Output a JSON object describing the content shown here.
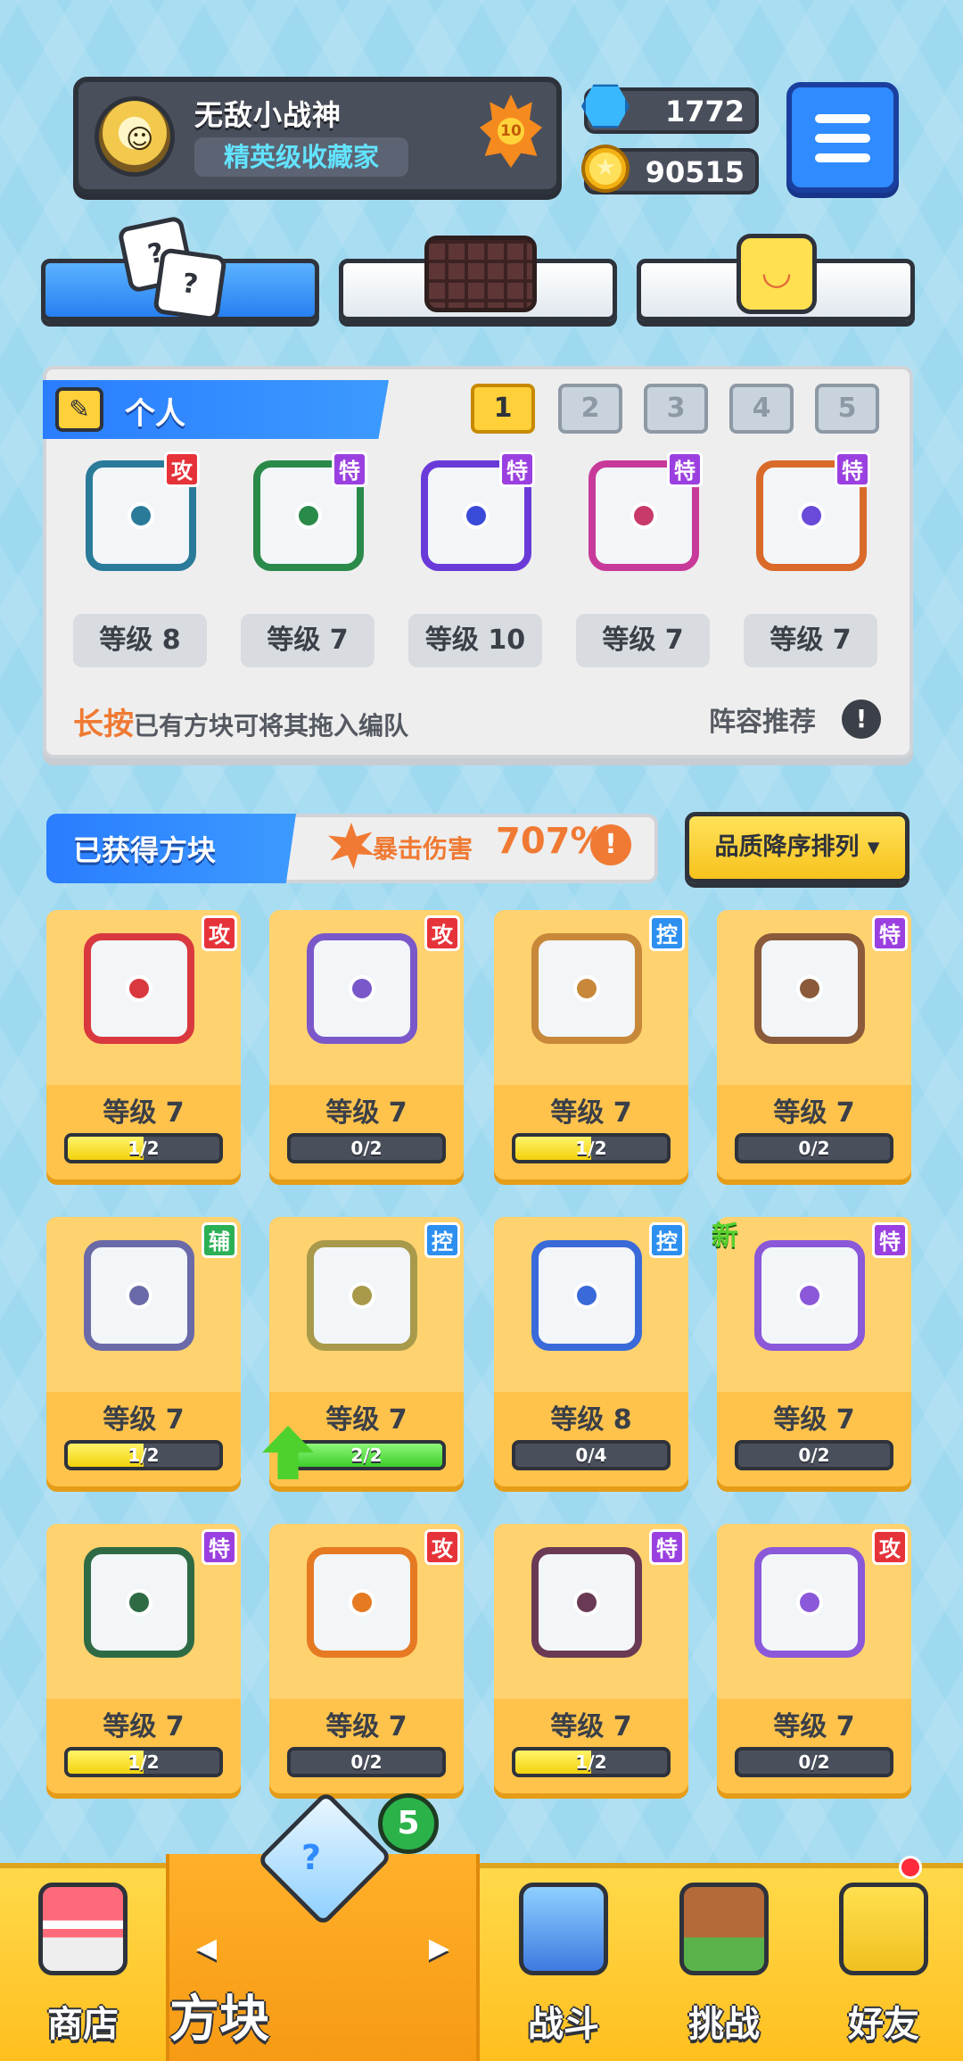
{
  "header": {
    "username": "无敌小战神",
    "rank": "精英级收藏家",
    "player_level": "10",
    "gems": "1772",
    "coins": "90515"
  },
  "top_tabs": [
    {
      "icon": "dice-icon",
      "active": true
    },
    {
      "icon": "grid-icon",
      "active": false
    },
    {
      "icon": "smile-icon",
      "active": false
    }
  ],
  "deck": {
    "title": "个人",
    "deck_numbers": [
      "1",
      "2",
      "3",
      "4",
      "5"
    ],
    "active_deck": "1",
    "slots": [
      {
        "tag": "攻",
        "level": "等级 8"
      },
      {
        "tag": "特",
        "level": "等级 7"
      },
      {
        "tag": "特",
        "level": "等级 10"
      },
      {
        "tag": "特",
        "level": "等级 7"
      },
      {
        "tag": "特",
        "level": "等级 7"
      }
    ],
    "hint_strong": "长按",
    "hint_rest": "已有方块可将其拖入编队",
    "recommend": "阵容推荐",
    "info_symbol": "!"
  },
  "obtained": {
    "title": "已获得方块",
    "crit_label": "暴击伤害",
    "crit_value": "707%",
    "info_symbol": "!",
    "sort_label": "品质降序排列 ▾"
  },
  "cards": [
    {
      "tag": "攻",
      "level": "等级 7",
      "progress": "1/2",
      "fraction": 0.5,
      "color": "#d9383e"
    },
    {
      "tag": "攻",
      "level": "等级 7",
      "progress": "0/2",
      "fraction": 0,
      "color": "#7a58c9"
    },
    {
      "tag": "控",
      "level": "等级 7",
      "progress": "1/2",
      "fraction": 0.5,
      "color": "#c8883a"
    },
    {
      "tag": "特",
      "level": "等级 7",
      "progress": "0/2",
      "fraction": 0,
      "color": "#8a5a3a"
    },
    {
      "tag": "辅",
      "level": "等级 7",
      "progress": "1/2",
      "fraction": 0.5,
      "color": "#6a6aa8"
    },
    {
      "tag": "控",
      "level": "等级 7",
      "progress": "2/2",
      "fraction": 1,
      "color": "#a89a4a"
    },
    {
      "tag": "控",
      "level": "等级 8",
      "progress": "0/4",
      "fraction": 0,
      "color": "#3a6ad9"
    },
    {
      "tag": "特",
      "level": "等级 7",
      "progress": "0/2",
      "fraction": 0,
      "color": "#8a58d9",
      "new": "新"
    },
    {
      "tag": "特",
      "level": "等级 7",
      "progress": "1/2",
      "fraction": 0.5,
      "color": "#2e6a44"
    },
    {
      "tag": "攻",
      "level": "等级 7",
      "progress": "0/2",
      "fraction": 0,
      "color": "#e67a22"
    },
    {
      "tag": "特",
      "level": "等级 7",
      "progress": "1/2",
      "fraction": 0.5,
      "color": "#6a3a54"
    },
    {
      "tag": "攻",
      "level": "等级 7",
      "progress": "0/2",
      "fraction": 0,
      "color": "#8a58d9"
    }
  ],
  "nav": {
    "shop": "商店",
    "dice": "方块",
    "dice_badge": "5",
    "battle": "战斗",
    "challenge": "挑战",
    "friends": "好友"
  },
  "colors": {
    "accent_blue": "#2f8bff",
    "gold": "#ffc34c",
    "crit_orange": "#f07a33"
  }
}
